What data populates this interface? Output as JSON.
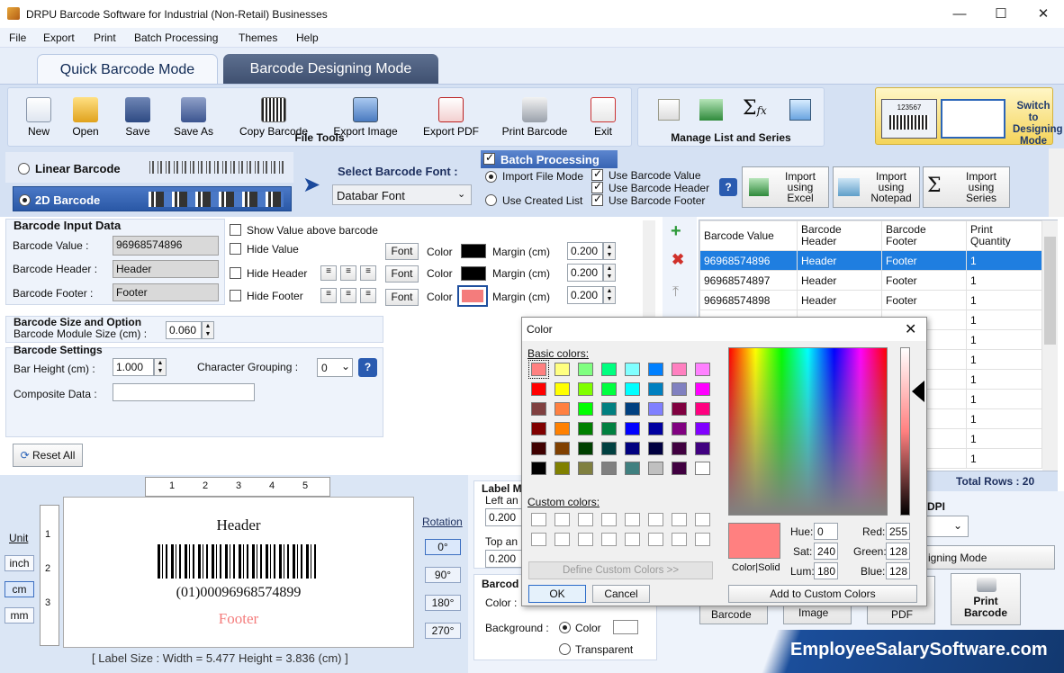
{
  "window": {
    "title": "DRPU Barcode Software for Industrial (Non-Retail) Businesses",
    "minimize": "—",
    "maximize": "☐",
    "close": "✕"
  },
  "menu": [
    "File",
    "Export",
    "Print",
    "Batch Processing",
    "Themes",
    "Help"
  ],
  "tabs": {
    "quick": "Quick Barcode Mode",
    "designing": "Barcode Designing Mode"
  },
  "file_tools": {
    "group_label": "File Tools",
    "items": [
      "New",
      "Open",
      "Save",
      "Save As",
      "Copy Barcode",
      "Export Image",
      "Export PDF",
      "Print Barcode",
      "Exit"
    ]
  },
  "manage": {
    "group_label": "Manage List and Series"
  },
  "switch_button": {
    "line1": "Switch to",
    "line2": "Designing",
    "line3": "Mode",
    "preview_number": "123567"
  },
  "barcode_type": {
    "linear": "Linear Barcode",
    "twod": "2D Barcode",
    "selected": "2D Barcode"
  },
  "font_select": {
    "label": "Select Barcode Font :",
    "value": "Databar Font"
  },
  "batch": {
    "title": "Batch Processing",
    "import_file_mode": "Import File Mode",
    "use_created_list": "Use Created List",
    "use_value": "Use Barcode Value",
    "use_header": "Use Barcode Header",
    "use_footer": "Use Barcode Footer",
    "help": "?",
    "import_excel": [
      "Import",
      "using",
      "Excel"
    ],
    "import_notepad": [
      "Import",
      "using",
      "Notepad"
    ],
    "import_series": [
      "Import",
      "using",
      "Series"
    ]
  },
  "input_data": {
    "title": "Barcode Input Data",
    "value_label": "Barcode Value :",
    "value": "96968574896",
    "header_label": "Barcode Header :",
    "header": "Header",
    "footer_label": "Barcode Footer :",
    "footer": "Footer"
  },
  "display_opts": {
    "show_above": "Show Value above barcode",
    "hide_value": "Hide Value",
    "hide_header": "Hide Header",
    "hide_footer": "Hide Footer",
    "font": "Font",
    "color": "Color",
    "margin": "Margin (cm)",
    "margin_value": "0.200",
    "margin_header": "0.200",
    "margin_footer": "0.200",
    "footer_color": "#f47c7c"
  },
  "size_option": {
    "title": "Barcode Size and Option",
    "module_label": "Barcode Module Size (cm) :",
    "module_value": "0.060"
  },
  "settings": {
    "title": "Barcode Settings",
    "bar_height_label": "Bar Height (cm) :",
    "bar_height": "1.000",
    "char_group_label": "Character Grouping :",
    "char_group": "0",
    "composite_label": "Composite Data :",
    "composite": "",
    "help": "?"
  },
  "reset": "Reset All",
  "grid": {
    "columns": [
      [
        "Barcode Value"
      ],
      [
        "Barcode",
        "Header"
      ],
      [
        "Barcode",
        "Footer"
      ],
      [
        "Print",
        "Quantity"
      ]
    ],
    "rows": [
      [
        "96968574896",
        "Header",
        "Footer",
        "1"
      ],
      [
        "96968574897",
        "Header",
        "Footer",
        "1"
      ],
      [
        "96968574898",
        "Header",
        "Footer",
        "1"
      ],
      [
        "",
        "",
        "",
        "1"
      ],
      [
        "",
        "",
        "",
        "1"
      ],
      [
        "",
        "",
        "",
        "1"
      ],
      [
        "",
        "",
        "",
        "1"
      ],
      [
        "",
        "",
        "",
        "1"
      ],
      [
        "",
        "",
        "",
        "1"
      ],
      [
        "",
        "",
        "",
        "1"
      ],
      [
        "",
        "",
        "",
        "1"
      ]
    ],
    "total_rows": "Total Rows : 20"
  },
  "preview": {
    "unit": "Unit",
    "units": [
      "inch",
      "cm",
      "mm"
    ],
    "ruler": [
      "1",
      "2",
      "3",
      "4",
      "5"
    ],
    "vruler": [
      "1",
      "2",
      "3"
    ],
    "header": "Header",
    "human_readable": "(01)00096968574899",
    "footer": "Footer",
    "label_size": "[ Label Size : Width = 5.477  Height = 3.836 (cm) ]",
    "rotation": "Rotation",
    "rotations": [
      "0°",
      "90°",
      "180°",
      "270°"
    ]
  },
  "label_margins": {
    "title": "Label M",
    "left": "Left an",
    "left_value": "0.200",
    "top": "Top an",
    "top_value": "0.200"
  },
  "barcode_color": {
    "title": "Barcod",
    "color": "Color :",
    "background": "Background :",
    "bg_color": "Color",
    "transparent": "Transparent"
  },
  "dpi": {
    "label": "DPI"
  },
  "bottom_actions": {
    "designing": "igning Mode",
    "barcode": "Barcode",
    "image": "Image",
    "pdf": "PDF",
    "print": [
      "Print",
      "Barcode"
    ]
  },
  "watermark": "EmployeeSalarySoftware.com",
  "color_dialog": {
    "title": "Color",
    "basic": "Basic colors:",
    "custom": "Custom colors:",
    "define": "Define Custom Colors >>",
    "ok": "OK",
    "cancel": "Cancel",
    "color_solid": "Color|Solid",
    "add": "Add to Custom Colors",
    "hue_label": "Hue:",
    "hue": "0",
    "sat_label": "Sat:",
    "sat": "240",
    "lum_label": "Lum:",
    "lum": "180",
    "red_label": "Red:",
    "red": "255",
    "green_label": "Green:",
    "green": "128",
    "blue_label": "Blue:",
    "blue": "128",
    "selected_color": "#ff8080",
    "basic_colors": [
      "#ff8080",
      "#ffff80",
      "#80ff80",
      "#00ff80",
      "#80ffff",
      "#0080ff",
      "#ff80c0",
      "#ff80ff",
      "#ff0000",
      "#ffff00",
      "#80ff00",
      "#00ff40",
      "#00ffff",
      "#0080c0",
      "#8080c0",
      "#ff00ff",
      "#804040",
      "#ff8040",
      "#00ff00",
      "#008080",
      "#004080",
      "#8080ff",
      "#800040",
      "#ff0080",
      "#800000",
      "#ff8000",
      "#008000",
      "#008040",
      "#0000ff",
      "#0000a0",
      "#800080",
      "#8000ff",
      "#400000",
      "#804000",
      "#004000",
      "#004040",
      "#000080",
      "#000040",
      "#400040",
      "#400080",
      "#000000",
      "#808000",
      "#808040",
      "#808080",
      "#408080",
      "#c0c0c0",
      "#400040",
      "#ffffff"
    ]
  }
}
